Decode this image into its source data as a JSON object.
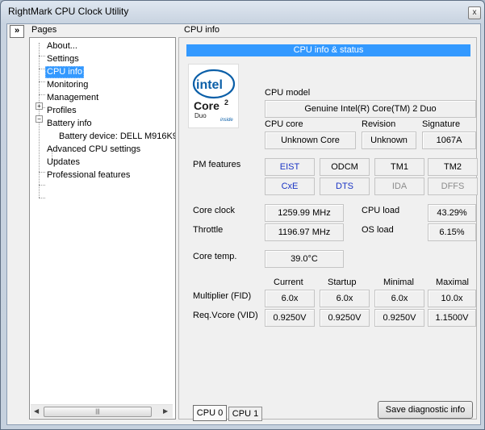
{
  "window": {
    "title": "RightMark CPU Clock Utility",
    "close_glyph": "x"
  },
  "sidebar": {
    "toggle_glyph": "»",
    "label": "Pages",
    "items": [
      {
        "label": "About..."
      },
      {
        "label": "Settings"
      },
      {
        "label": "CPU info"
      },
      {
        "label": "Monitoring"
      },
      {
        "label": "Management"
      },
      {
        "label": "Profiles",
        "expander": "+"
      },
      {
        "label": "Battery info",
        "expander": "−"
      },
      {
        "label": "Battery device: DELL M916K9"
      },
      {
        "label": "Advanced CPU settings"
      },
      {
        "label": "Updates"
      },
      {
        "label": "Professional features"
      }
    ],
    "scroll": {
      "left": "◀",
      "right": "▶",
      "grip": "|||"
    }
  },
  "panel": {
    "title": "CPU info",
    "banner": "CPU info & status",
    "logo": {
      "brand": "intel",
      "product": "Core",
      "sup": "2",
      "sub": "Duo",
      "tag": "inside"
    },
    "cpu_model": {
      "label": "CPU model",
      "value": "Genuine Intel(R) Core(TM) 2 Duo"
    },
    "cpu_core": {
      "label": "CPU core",
      "value": "Unknown Core"
    },
    "revision": {
      "label": "Revision",
      "value": "Unknown"
    },
    "signature": {
      "label": "Signature",
      "value": "1067A"
    },
    "pm_features": {
      "label": "PM features",
      "items": [
        {
          "label": "EIST",
          "state": "on"
        },
        {
          "label": "ODCM",
          "state": "normal"
        },
        {
          "label": "TM1",
          "state": "normal"
        },
        {
          "label": "TM2",
          "state": "normal"
        },
        {
          "label": "CxE",
          "state": "on"
        },
        {
          "label": "DTS",
          "state": "on"
        },
        {
          "label": "IDA",
          "state": "off"
        },
        {
          "label": "DFFS",
          "state": "off"
        }
      ]
    },
    "core_clock": {
      "label": "Core clock",
      "value": "1259.99 MHz"
    },
    "throttle": {
      "label": "Throttle",
      "value": "1196.97 MHz"
    },
    "cpu_load": {
      "label": "CPU load",
      "value": "43.29%"
    },
    "os_load": {
      "label": "OS load",
      "value": "6.15%"
    },
    "core_temp": {
      "label": "Core temp.",
      "value": "39.0°C"
    },
    "table": {
      "columns": [
        "Current",
        "Startup",
        "Minimal",
        "Maximal"
      ],
      "rows": [
        {
          "label": "Multiplier (FID)",
          "values": [
            "6.0x",
            "6.0x",
            "6.0x",
            "10.0x"
          ]
        },
        {
          "label": "Req.Vcore (VID)",
          "values": [
            "0.9250V",
            "0.9250V",
            "0.9250V",
            "1.1500V"
          ]
        }
      ]
    },
    "cpu_tabs": [
      "CPU 0",
      "CPU 1"
    ],
    "save_button": "Save diagnostic info"
  },
  "colors": {
    "selection": "#3399ff",
    "pm_enabled": "#1a34c4",
    "pm_disabled": "#8b8b8b"
  }
}
